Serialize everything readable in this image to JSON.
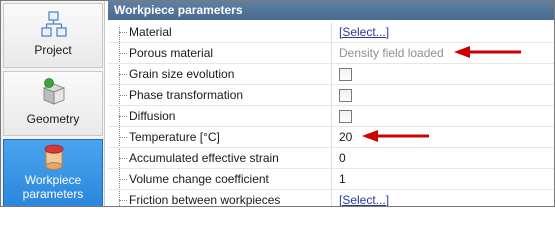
{
  "sidebar": {
    "items": [
      {
        "label": "Project",
        "icon": "project-tree-icon"
      },
      {
        "label": "Geometry",
        "icon": "geometry-blocks-icon"
      },
      {
        "label": "Workpiece parameters",
        "icon": "workpiece-cylinder-icon",
        "selected": true
      }
    ]
  },
  "panel": {
    "title": "Workpiece parameters",
    "rows": [
      {
        "name": "Material",
        "value": "[Select...]",
        "kind": "link"
      },
      {
        "name": "Porous material",
        "value": "Density field loaded",
        "kind": "readonly"
      },
      {
        "name": "Grain size evolution",
        "kind": "checkbox",
        "checked": false
      },
      {
        "name": "Phase transformation",
        "kind": "checkbox",
        "checked": false
      },
      {
        "name": "Diffusion",
        "kind": "checkbox",
        "checked": false
      },
      {
        "name": "Temperature [°C]",
        "value": "20",
        "kind": "text"
      },
      {
        "name": "Accumulated effective strain",
        "value": "0",
        "kind": "text"
      },
      {
        "name": "Volume change coefficient",
        "value": "1",
        "kind": "text"
      },
      {
        "name": "Friction between workpieces",
        "value": "[Select...]",
        "kind": "link"
      }
    ]
  },
  "colors": {
    "header": "#4f6f95",
    "selected_nav": "#3b95e8",
    "arrow": "#cc0000"
  }
}
